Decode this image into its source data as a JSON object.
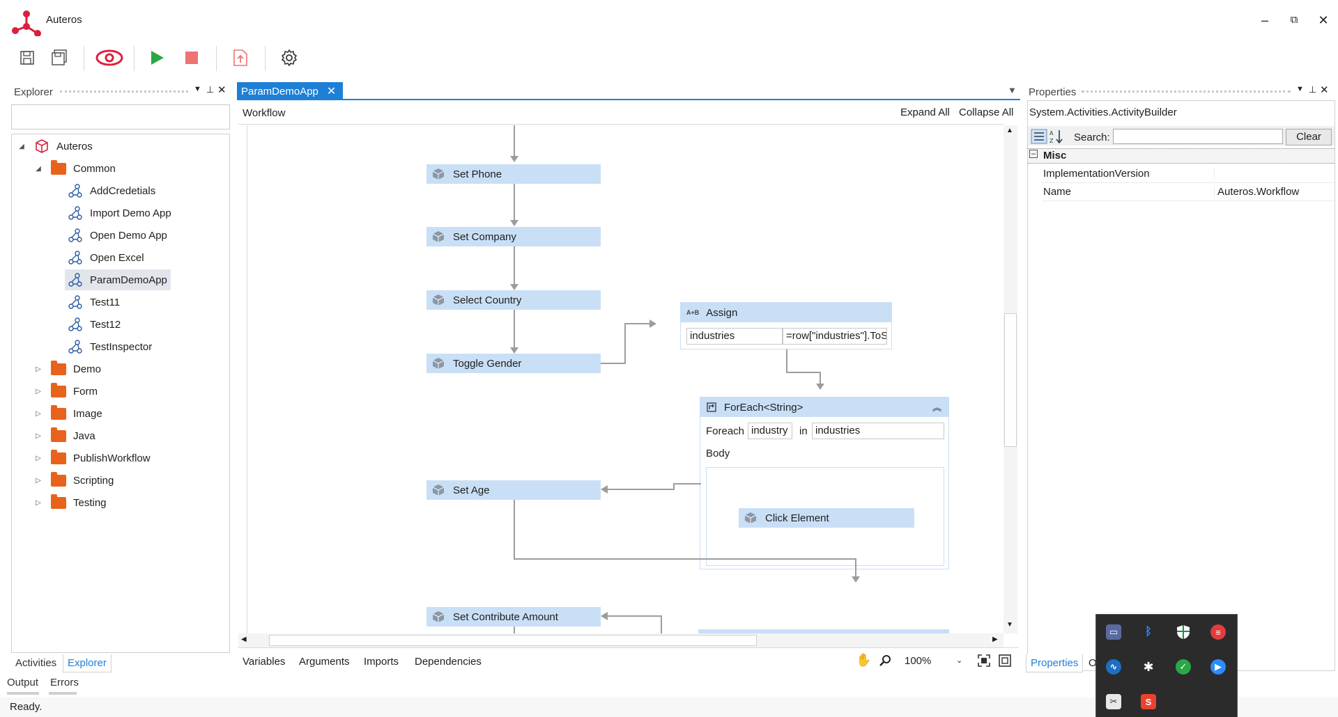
{
  "app": {
    "title": "Auteros"
  },
  "window_controls": {
    "minimize": "–",
    "restore": "⧉",
    "close": "✕"
  },
  "explorer": {
    "title": "Explorer",
    "search_value": "",
    "tree": [
      {
        "label": "Autoros_root",
        "text": "Auteros"
      },
      {
        "text": "Common"
      },
      {
        "text": "AddCredetials"
      },
      {
        "text": "Import Demo App"
      },
      {
        "text": "Open Demo App"
      },
      {
        "text": "Open Excel"
      },
      {
        "text": "ParamDemoApp"
      },
      {
        "text": "Test11"
      },
      {
        "text": "Test12"
      },
      {
        "text": "TestInspector"
      },
      {
        "text": "Demo"
      },
      {
        "text": "Form"
      },
      {
        "text": "Image"
      },
      {
        "text": "Java"
      },
      {
        "text": "PublishWorkflow"
      },
      {
        "text": "Scripting"
      },
      {
        "text": "Testing"
      }
    ],
    "bottom_tabs": [
      "Activities",
      "Explorer"
    ]
  },
  "document": {
    "tab_label": "ParamDemoApp",
    "breadcrumb": "Workflow",
    "expand_all": "Expand All",
    "collapse_all": "Collapse All",
    "activities": {
      "set_phone": "Set Phone",
      "set_company": "Set Company",
      "select_country": "Select Country",
      "toggle_gender": "Toggle Gender",
      "set_age": "Set Age",
      "set_contribute": "Set Contribute Amount"
    },
    "assign": {
      "title": "Assign",
      "badge": "A+B",
      "to": "industries",
      "value": "=row[\"industries\"].ToS"
    },
    "foreach": {
      "title": "ForEach<String>",
      "foreach_label": "Foreach",
      "item": "industry",
      "in_label": "in",
      "collection": "industries",
      "body_label": "Body",
      "child": "Click Element"
    },
    "bottom_tabs": [
      "Variables",
      "Arguments",
      "Imports",
      "Dependencies"
    ],
    "zoom": "100%"
  },
  "properties": {
    "title": "Properties",
    "object": "System.Activities.ActivityBuilder",
    "search_label": "Search:",
    "search_value": "",
    "clear_label": "Clear",
    "category": "Misc",
    "rows": [
      {
        "name": "ImplementationVersion",
        "value": ""
      },
      {
        "name": "Name",
        "value": "Auteros.Workflow"
      }
    ],
    "bottom_tab": "Properties",
    "bottom_tab_partial": "O"
  },
  "output_tabs": [
    "Output",
    "Errors"
  ],
  "status": {
    "text": "Ready."
  },
  "colors": {
    "accent": "#1e7fd6",
    "activity": "#c9dff6",
    "folder": "#e8621c",
    "run": "#2aa845",
    "stop": "#ef7373",
    "logo": "#d81f3d"
  }
}
